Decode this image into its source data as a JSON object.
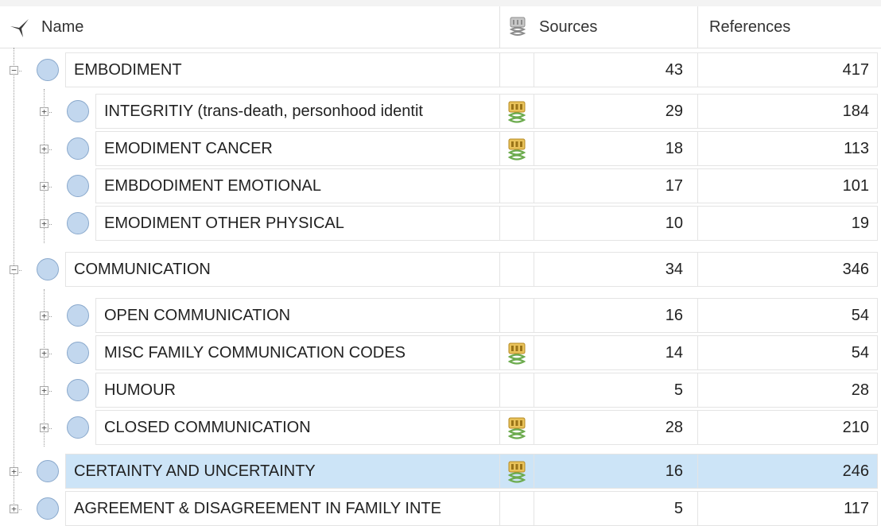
{
  "header": {
    "name_label": "Name",
    "sources_label": "Sources",
    "references_label": "References",
    "pin_icon": "pin-icon",
    "aggregate_icon": "aggregate-icon"
  },
  "colors": {
    "selection": "#cce4f7",
    "node_fill": "#c2d7ee",
    "aggregate_icon": "#e3b43a"
  },
  "rows": [
    {
      "name": "EMBODIMENT",
      "sources": "43",
      "references": "417",
      "level": 0,
      "expander": "collapse",
      "aggregate": false,
      "selected": false
    },
    {
      "name": "INTEGRITIY (trans-death, personhood identit",
      "sources": "29",
      "references": "184",
      "level": 1,
      "expander": "expand",
      "aggregate": true,
      "selected": false
    },
    {
      "name": "EMODIMENT CANCER",
      "sources": "18",
      "references": "113",
      "level": 1,
      "expander": "expand",
      "aggregate": true,
      "selected": false
    },
    {
      "name": "EMBDODIMENT EMOTIONAL",
      "sources": "17",
      "references": "101",
      "level": 1,
      "expander": "expand",
      "aggregate": false,
      "selected": false
    },
    {
      "name": "EMODIMENT OTHER PHYSICAL",
      "sources": "10",
      "references": "19",
      "level": 1,
      "expander": "expand",
      "aggregate": false,
      "selected": false
    },
    {
      "name": "COMMUNICATION",
      "sources": "34",
      "references": "346",
      "level": 0,
      "expander": "collapse",
      "aggregate": false,
      "selected": false
    },
    {
      "name": "OPEN COMMUNICATION",
      "sources": "16",
      "references": "54",
      "level": 1,
      "expander": "expand",
      "aggregate": false,
      "selected": false
    },
    {
      "name": "MISC FAMILY COMMUNICATION CODES",
      "sources": "14",
      "references": "54",
      "level": 1,
      "expander": "expand",
      "aggregate": true,
      "selected": false
    },
    {
      "name": "HUMOUR",
      "sources": "5",
      "references": "28",
      "level": 1,
      "expander": "expand",
      "aggregate": false,
      "selected": false
    },
    {
      "name": "CLOSED COMMUNICATION",
      "sources": "28",
      "references": "210",
      "level": 1,
      "expander": "expand",
      "aggregate": true,
      "selected": false
    },
    {
      "name": "CERTAINTY AND UNCERTAINTY",
      "sources": "16",
      "references": "246",
      "level": 0,
      "expander": "expand",
      "aggregate": true,
      "selected": true
    },
    {
      "name": "AGREEMENT & DISAGREEMENT IN FAMILY INTE",
      "sources": "5",
      "references": "117",
      "level": 0,
      "expander": "expand",
      "aggregate": false,
      "selected": false
    }
  ]
}
